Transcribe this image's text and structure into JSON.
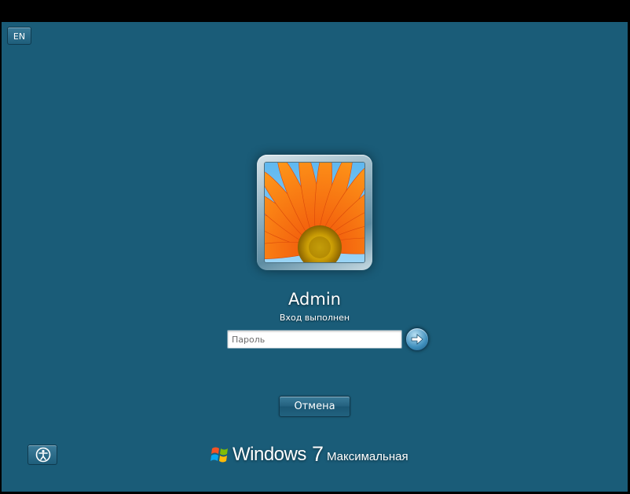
{
  "top_bar": {
    "language_button": "EN"
  },
  "user": {
    "name": "Admin",
    "status": "Вход выполнен",
    "avatar_icon": "flower-avatar-icon"
  },
  "password": {
    "placeholder": "Пароль",
    "value": ""
  },
  "actions": {
    "submit_icon": "arrow-right-icon",
    "cancel_label": "Отмена",
    "ease_of_access_icon": "ease-of-access-icon"
  },
  "branding": {
    "product": "Windows",
    "version": "7",
    "edition": "Максимальная",
    "logo_icon": "windows-flag-icon"
  },
  "colors": {
    "background": "#1a5c78",
    "text": "#ffffff"
  }
}
